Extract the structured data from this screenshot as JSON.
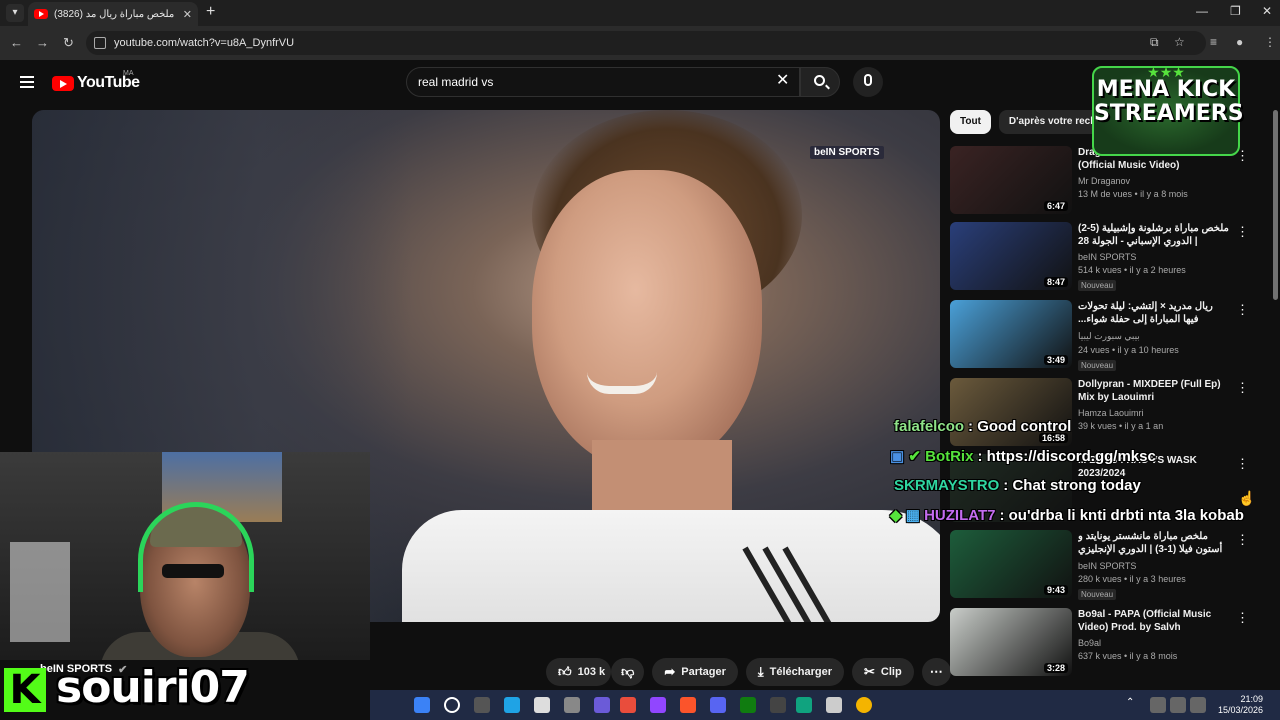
{
  "browser": {
    "tab_title": "ملخص مباراة ريال مد (3826)",
    "url": "youtube.com/watch?v=u8A_DynfrVU"
  },
  "youtube": {
    "logo_text": "YouTube",
    "region": "MA",
    "search_query": "real madrid vs",
    "channel_name": "beIN SPORTS",
    "actions": {
      "likes": "103 k",
      "share": "Partager",
      "download": "Télécharger",
      "clip": "Clip"
    },
    "chips": [
      "Tout",
      "D'après votre reche"
    ],
    "recommendations": [
      {
        "title": "Draganov - ... BON COURAGE (Official Music Video)",
        "channel": "Mr Draganov",
        "meta": "13 M de vues • il y a 8 mois",
        "duration": "6:47",
        "badge": "",
        "thumb_color": "#3a2323"
      },
      {
        "title": "ملخص مباراة برشلونة وإشبيلية (5-2) | الدوري الإسباني - الجولة 28",
        "channel": "beIN SPORTS",
        "meta": "514 k vues • il y a 2 heures",
        "duration": "8:47",
        "badge": "Nouveau",
        "thumb_color": "#2a3f7a"
      },
      {
        "title": "ريال مدريد × إلتشي: ليلة تحولات فيها المباراة إلى حفلة شواء... والضيف كان اللحم!",
        "channel": "بيبي سبورت ليبيا",
        "meta": "24 vues • il y a 10 heures",
        "duration": "3:49",
        "badge": "Nouveau",
        "thumb_color": "#4aa0d8"
      },
      {
        "title": "Dollypran - MIXDEEP (Full Ep) Mix by Laouimri",
        "channel": "Hamza Laouimri",
        "meta": "39 k vues • il y a 1 an",
        "duration": "16:58",
        "badge": "",
        "thumb_color": "#6b5a3c"
      },
      {
        "title": "... BOYS : KAC VS WASK 2023/2024",
        "channel": "",
        "meta": "",
        "duration": "",
        "badge": "",
        "thumb_color": "#1f2b22"
      },
      {
        "title": "ملخص مباراة مانشستر يونايتد و أستون فيلا (1-3) | الدوري الإنجليزي الممتاز - الجولة ...",
        "channel": "beIN SPORTS",
        "meta": "280 k vues • il y a 3 heures",
        "duration": "9:43",
        "badge": "Nouveau",
        "thumb_color": "#1d5d3b"
      },
      {
        "title": "Bo9al - PAPA (Official Music Video) Prod. by Salvh",
        "channel": "Bo9al",
        "meta": "637 k vues • il y a 8 mois",
        "duration": "3:28",
        "badge": "",
        "thumb_color": "#c9cdc9"
      }
    ]
  },
  "video": {
    "broadcaster_bug": "beIN SPORTS"
  },
  "overlay": {
    "streamer_name": "souiri07",
    "kick_letter": "K",
    "logo_lines": [
      "MENA KICK",
      "STREAMERS"
    ],
    "chat": [
      {
        "user": "falafelcoo",
        "message": ": Good control",
        "color": "#8fe388"
      },
      {
        "user": "BotRix",
        "message": ": https://discord.gg/mksc",
        "color": "#56e33c"
      },
      {
        "user": "SKRMAYSTRO",
        "message": ": Chat strong today",
        "color": "#2fd6a0"
      },
      {
        "user": "HUZILAT7",
        "message": ": ou'drba li knti drbti nta 3la kobab",
        "color": "#c46cf0"
      }
    ]
  },
  "taskbar": {
    "time": "21:09",
    "date": "15/03/2026"
  }
}
